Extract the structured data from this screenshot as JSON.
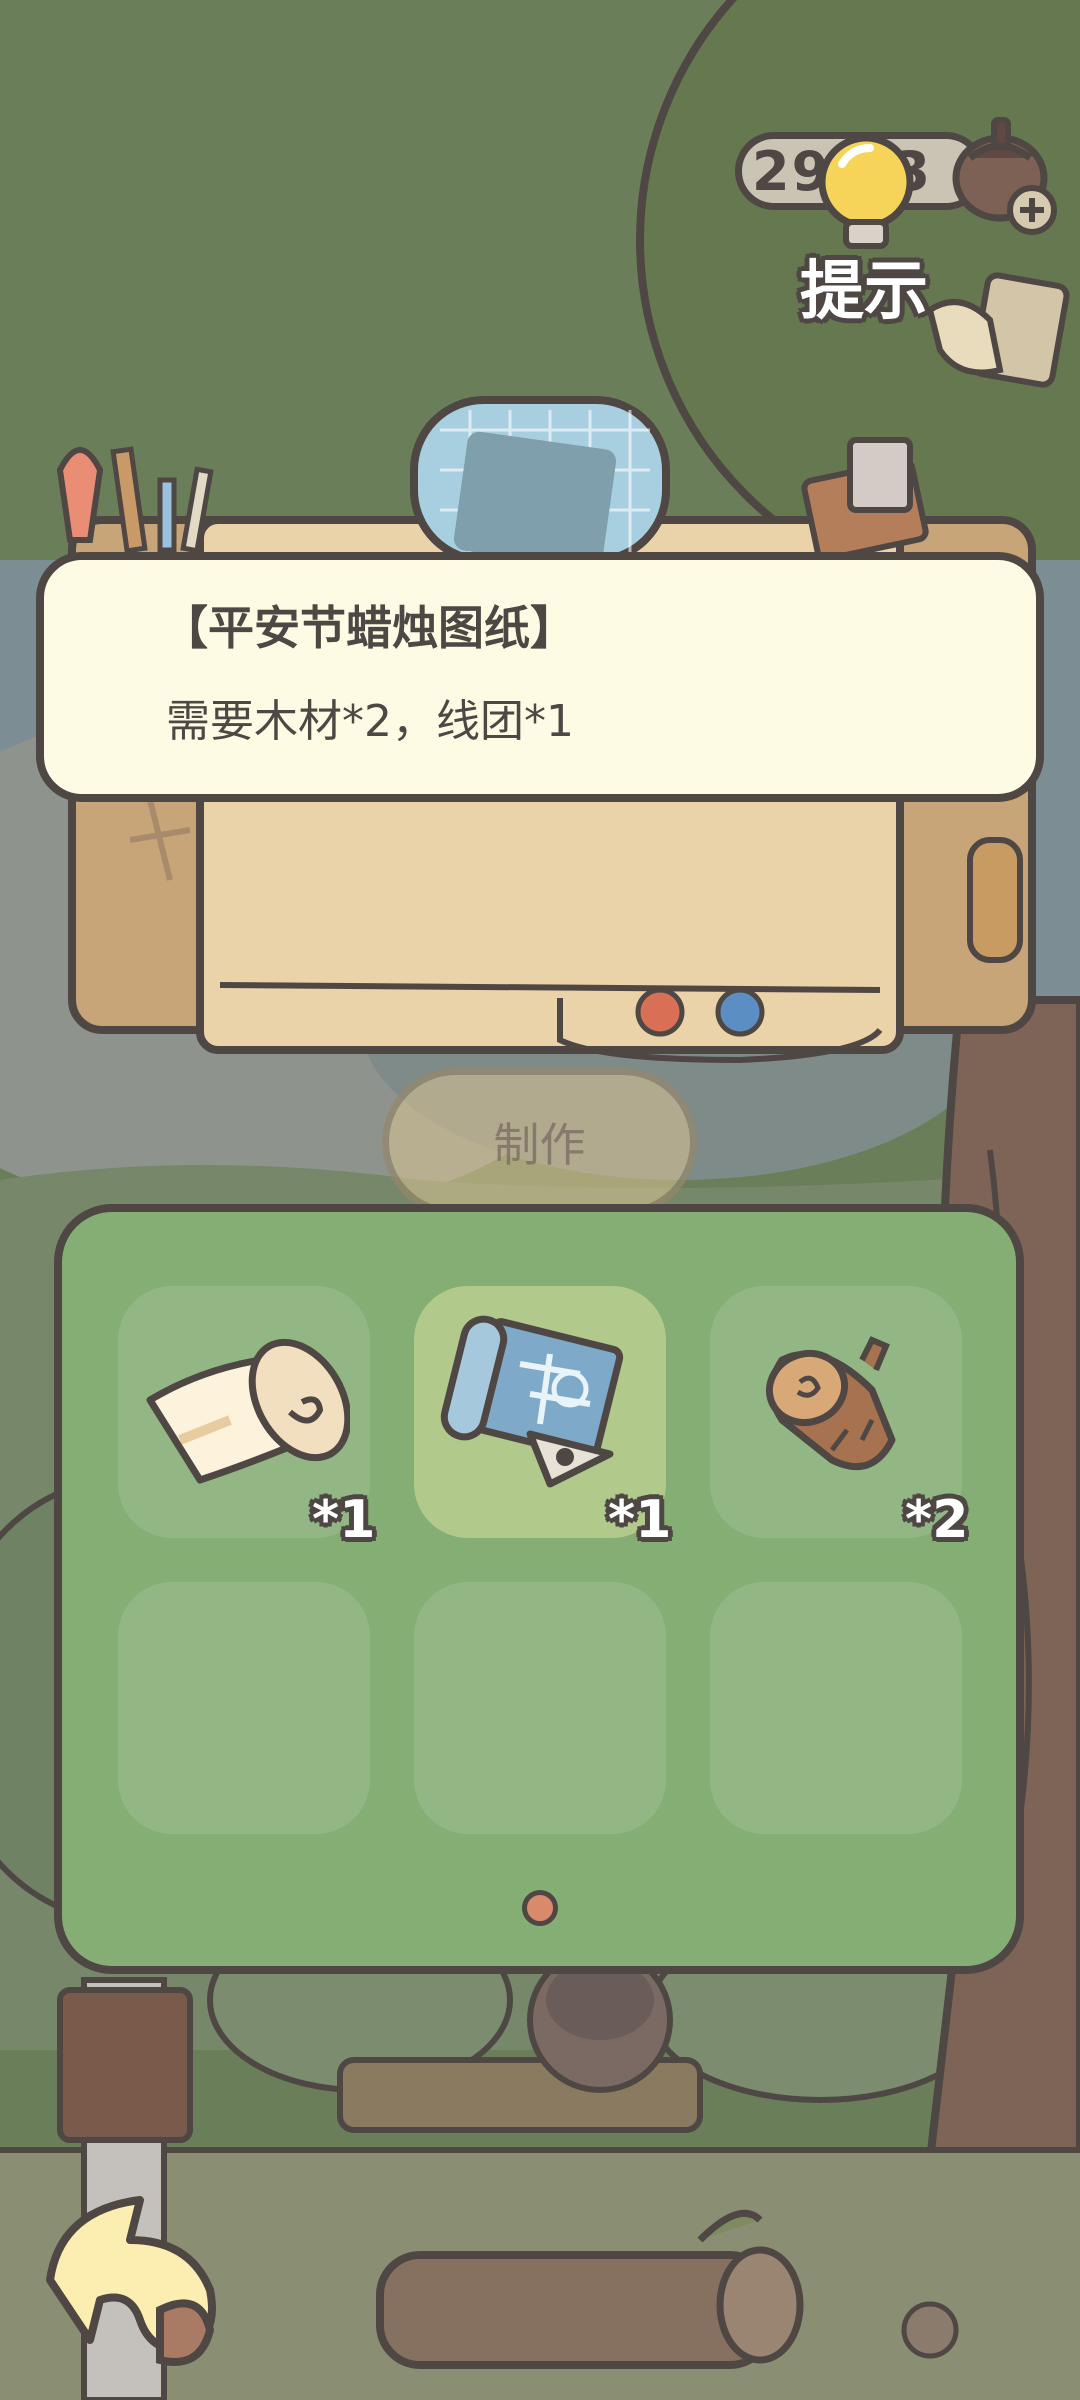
{
  "hint": {
    "counter": "29/33",
    "label": "提示",
    "icon": "lightbulb-icon",
    "add_icon": "plus-icon"
  },
  "blueprint": {
    "title": "【平安节蜡烛图纸】",
    "requirement": "需要木材*2，线团*1"
  },
  "craft_button": {
    "label": "制作"
  },
  "inventory": {
    "slots": [
      {
        "icon": "paper-scroll-icon",
        "qty": "*1",
        "selected": false
      },
      {
        "icon": "blueprint-icon",
        "qty": "*1",
        "selected": true
      },
      {
        "icon": "wood-log-icon",
        "qty": "*2",
        "selected": false
      },
      {
        "icon": "empty-slot",
        "qty": "",
        "selected": false
      },
      {
        "icon": "empty-slot",
        "qty": "",
        "selected": false
      },
      {
        "icon": "empty-slot",
        "qty": "",
        "selected": false
      }
    ],
    "page_current": 1,
    "page_total": 1
  },
  "back_button": {
    "icon": "back-arrow-icon"
  },
  "colors": {
    "outline": "#4e4744",
    "panel_green": "#85ae74",
    "popup_bg": "#fefbe5",
    "bulb_yellow": "#f6d45a",
    "page_dot": "#d98a6a"
  }
}
